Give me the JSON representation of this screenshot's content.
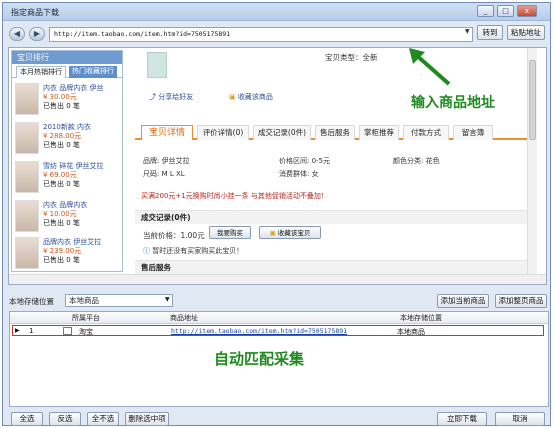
{
  "window": {
    "title": "指定商品下载",
    "min": "_",
    "max": "□",
    "close": "x"
  },
  "nav": {
    "back": "◀",
    "forward": "▶",
    "url": "http://item.taobao.com/item.htm?id=7505175891",
    "go_label": "转到",
    "paste_label": "粘贴地址"
  },
  "shop": {
    "header": "宝贝排行",
    "tabs": [
      "本月热销排行",
      "热门收藏排行"
    ],
    "items": [
      {
        "name": "内衣 品牌内衣 伊丝",
        "price": "¥ 30.00元",
        "sold": "已售出 0 笔"
      },
      {
        "name": "2010新款 内衣",
        "price": "¥ 288.00元",
        "sold": "已售出 0 笔"
      },
      {
        "name": "雪纺 碎花 伊丝艾拉",
        "price": "¥ 69.00元",
        "sold": "已售出 0 笔"
      },
      {
        "name": "内衣 品牌内衣",
        "price": "¥ 10.00元",
        "sold": "已售出 0 笔"
      },
      {
        "name": "品牌内衣 伊丝艾拉",
        "price": "¥ 239.00元",
        "sold": "已售出 0 笔"
      }
    ]
  },
  "product": {
    "type_label": "宝贝类型：全新",
    "share": "分享给好友",
    "fav": "收藏该商品",
    "tabs": [
      "宝贝详情",
      "评价详情(0)",
      "成交记录(0件)",
      "售后服务",
      "掌柜推荐",
      "付款方式",
      "留言簿"
    ],
    "attrs": {
      "brand": "品牌: 伊丝艾拉",
      "price_range": "价格区间: 0-5元",
      "color": "颜色分类: 花色",
      "size": "尺码: M L XL",
      "group": "消费群体: 女"
    },
    "promo": "买满200元+1元换购时尚小挂一条 与其他促销活动不叠加!",
    "records_title": "成交记录(0件)",
    "current_price": "当前价格：1.00元",
    "buy_label": "我要购买",
    "fav_store": "收藏该宝贝",
    "no_buyer": "暂时还没有买家购买此宝贝！",
    "after_sale": "售后服务"
  },
  "annotations": {
    "url_hint": "输入商品地址",
    "match_hint": "自动匹配采集"
  },
  "storage": {
    "label": "本地存储位置",
    "selected": "本地商品",
    "add_current": "添加当前商品",
    "add_page": "添加整页商品"
  },
  "grid": {
    "columns": [
      "所属平台",
      "商品地址",
      "本地存储位置"
    ],
    "rows": [
      {
        "index": "1",
        "platform": "淘宝",
        "url": "http://item.taobao.com/item.htm?id=7505175891",
        "store": "本地商品"
      }
    ]
  },
  "buttons": {
    "select_all": "全选",
    "invert": "反选",
    "deselect": "全不选",
    "delete_selected": "删除选中项",
    "download_now": "立即下载",
    "cancel": "取消"
  },
  "colors": {
    "accent": "#ef8e2c",
    "annotation": "#1f8a1f",
    "link": "#1a3fb0",
    "highlight_border": "#c0392b"
  }
}
